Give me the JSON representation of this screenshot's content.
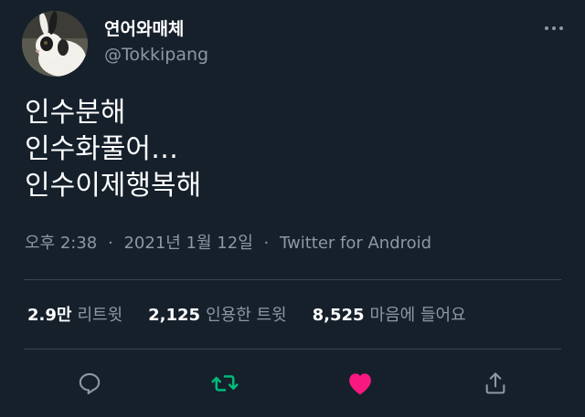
{
  "user": {
    "display_name": "연어와매체",
    "handle": "@Tokkipang",
    "avatar_icon": "rabbit-avatar"
  },
  "tweet": {
    "lines": [
      "인수분해",
      "인수화풀어…",
      "인수이제행복해"
    ]
  },
  "meta": {
    "time": "오후 2:38",
    "separator": "·",
    "date": "2021년 1월 12일",
    "source": "Twitter for Android"
  },
  "stats": {
    "retweets_count": "2.9만",
    "retweets_label": "리트윗",
    "quotes_count": "2,125",
    "quotes_label": "인용한 트윗",
    "likes_count": "8,525",
    "likes_label": "마음에 들어요"
  },
  "actions": {
    "reply_icon": "reply-icon",
    "retweet_icon": "retweet-icon",
    "like_icon": "heart-icon",
    "share_icon": "share-icon"
  },
  "colors": {
    "background": "#15202b",
    "muted": "#8b98a5",
    "retweet_green": "#00ba7c",
    "like_pink": "#f91880",
    "divider": "#38444d"
  }
}
